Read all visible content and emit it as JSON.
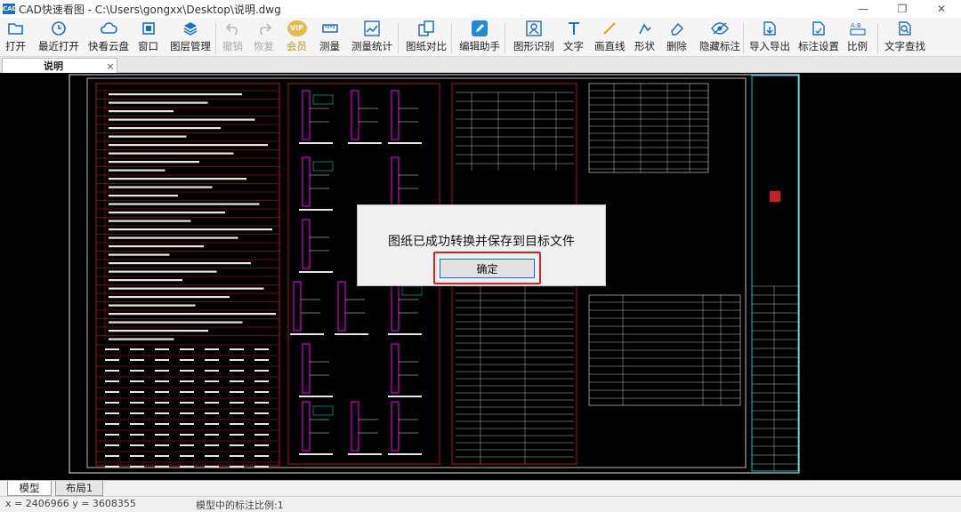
{
  "window": {
    "title": "CAD快速看图 - C:\\Users\\gongxx\\Desktop\\说明.dwg",
    "logo_text": "CAD",
    "minimize": "—",
    "restore": "❐",
    "close": "✕"
  },
  "toolbar": {
    "open": "打开",
    "recent": "最近打开",
    "cloud": "快看云盘",
    "window": "窗口",
    "layers": "图层管理",
    "undo": "撤销",
    "redo": "恢复",
    "vip": "会员",
    "vip_badge": "VIP",
    "measure": "测量",
    "measure_stats": "测量统计",
    "compare": "图纸对比",
    "edit_helper": "编辑助手",
    "shape_recog": "图形识别",
    "text": "文字",
    "line": "画直线",
    "shape": "形状",
    "delete": "删除",
    "hide_marks": "隐藏标注",
    "import_export": "导入导出",
    "mark_settings": "标注设置",
    "scale": "比例",
    "find_text": "文字查找"
  },
  "doc_tab": {
    "label": "说明",
    "close": "×"
  },
  "dialog": {
    "message": "图纸已成功转换并保存到目标文件",
    "ok": "确定",
    "highlight_color": "#e02020"
  },
  "layout_tabs": {
    "model": "模型",
    "layout1": "布局1"
  },
  "status": {
    "coords": "x = 2406966  y = 3608355",
    "scale_text": "模型中的标注比例:1"
  },
  "colors": {
    "canvas": "#000000",
    "drawing_red": "#d01c1c",
    "drawing_white": "#e6e6e6",
    "drawing_magenta": "#d000d0",
    "drawing_cyan": "#00c8c8",
    "accent_blue": "#0078d7"
  }
}
